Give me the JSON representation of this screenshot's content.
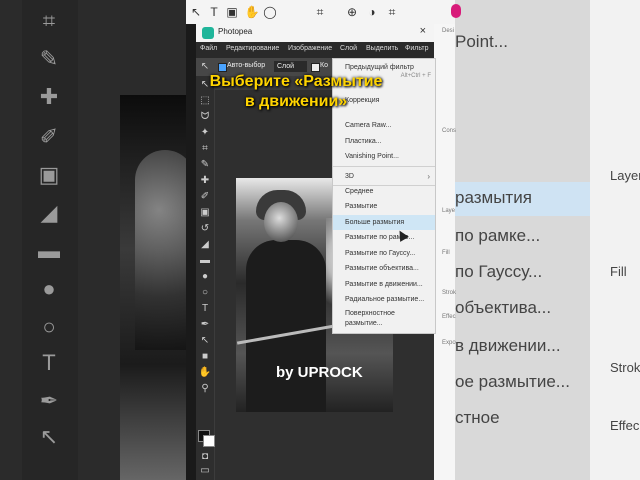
{
  "app": {
    "title": "Photopea",
    "close_label": "×"
  },
  "menubar": {
    "items": [
      "Файл",
      "Редактирование",
      "Изображение",
      "Слой",
      "Выделить",
      "Фильтр"
    ]
  },
  "options_bar": {
    "autoselect_label": "Авто-выбор",
    "layer_select": "Слой",
    "controls_label": "Ко"
  },
  "caption": {
    "line1": "Выберите «Размытие",
    "line2": "в движении»"
  },
  "filter_menu": {
    "items": [
      {
        "label": "Предыдущий фильтр",
        "shortcut": "Alt+Ctrl + F"
      },
      {
        "label": "Коррекция",
        "shortcut": ""
      },
      {
        "label": "Camera Raw...",
        "shortcut": ""
      },
      {
        "label": "Пластика...",
        "shortcut": ""
      },
      {
        "label": "Vanishing Point...",
        "shortcut": ""
      },
      {
        "label": "3D",
        "shortcut": ""
      },
      {
        "label": "Среднее",
        "shortcut": ""
      },
      {
        "label": "Размытие",
        "shortcut": ""
      },
      {
        "label": "Больше размытия",
        "shortcut": ""
      },
      {
        "label": "Размытие по рамке...",
        "shortcut": ""
      },
      {
        "label": "Размытие по Гауссу...",
        "shortcut": ""
      },
      {
        "label": "Размытие объектива...",
        "shortcut": ""
      },
      {
        "label": "Размытие в движении...",
        "shortcut": ""
      },
      {
        "label": "Радиальное размытие...",
        "shortcut": ""
      },
      {
        "label": "Поверхностное",
        "shortcut": ""
      },
      {
        "label": "размытие...",
        "shortcut": ""
      }
    ],
    "submenu_arrow": "›"
  },
  "watermark": "by UPROCK",
  "background_right": {
    "items": [
      "Point...",
      "размытия",
      "по рамке...",
      "по Гауссу...",
      "объектива...",
      "в движении...",
      "ое размытие...",
      "стное"
    ],
    "side": [
      "Layer",
      "Fill",
      "Strok",
      "Effec"
    ]
  },
  "sidepanel": {
    "labels": [
      "Desi",
      "Cons",
      "Laye",
      "Fill",
      "Strok",
      "Effec",
      "Expo"
    ]
  },
  "colors": {
    "caption": "#ffd400",
    "highlight": "#cfe6f5",
    "logo": "#1fb59a",
    "brand_pink": "#d81b7a"
  }
}
